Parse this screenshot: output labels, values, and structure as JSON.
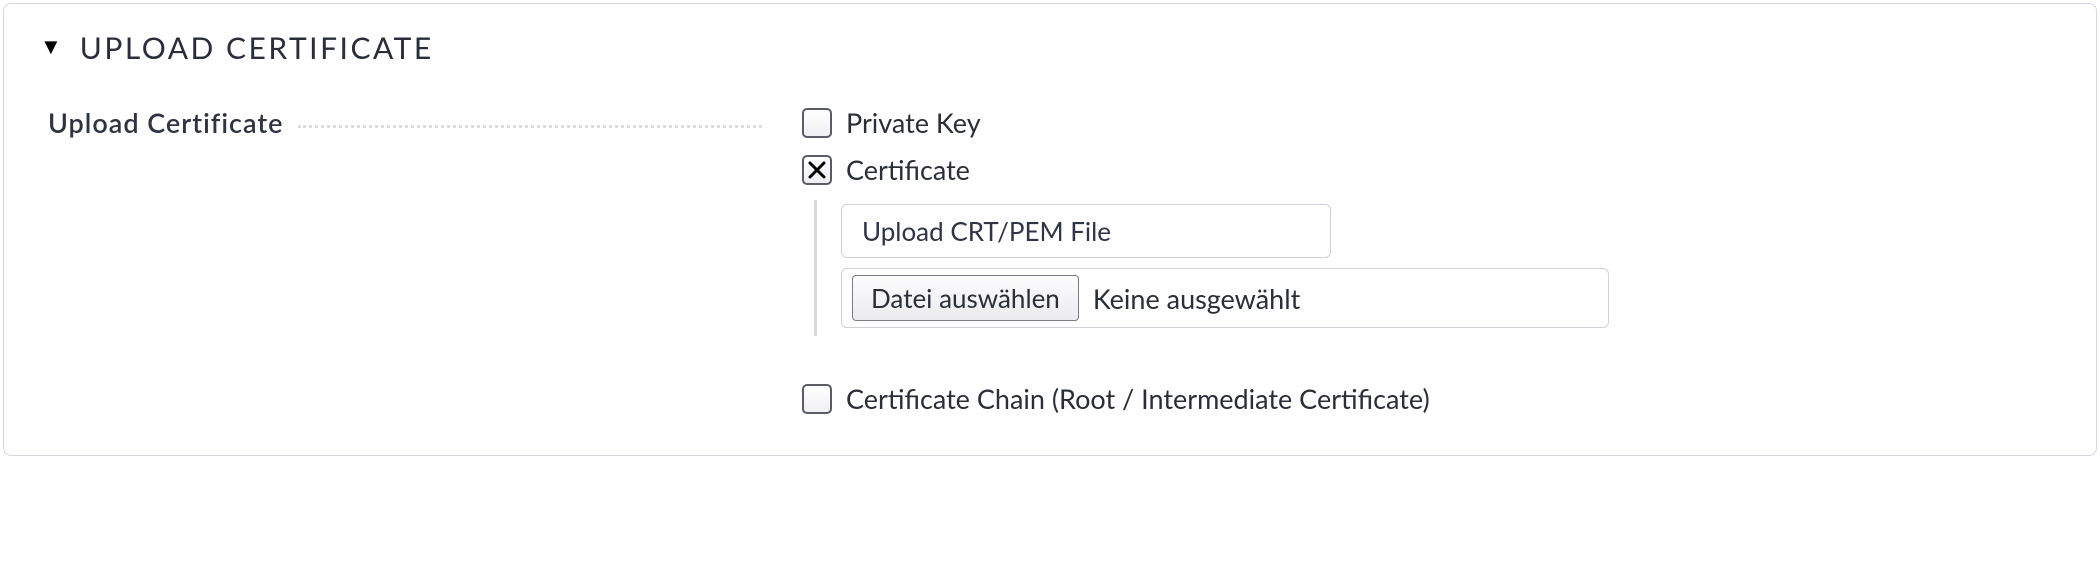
{
  "header": {
    "title": "UPLOAD CERTIFICATE"
  },
  "field": {
    "label": "Upload Certificate"
  },
  "options": {
    "private_key": {
      "label": "Private Key",
      "checked": false
    },
    "certificate": {
      "label": "Certificate",
      "checked": true,
      "upload_label": "Upload CRT/PEM File",
      "file_button": "Datei auswählen",
      "file_status": "Keine ausgewählt"
    },
    "chain": {
      "label": "Certificate Chain (Root / Intermediate Certificate)",
      "checked": false
    }
  }
}
